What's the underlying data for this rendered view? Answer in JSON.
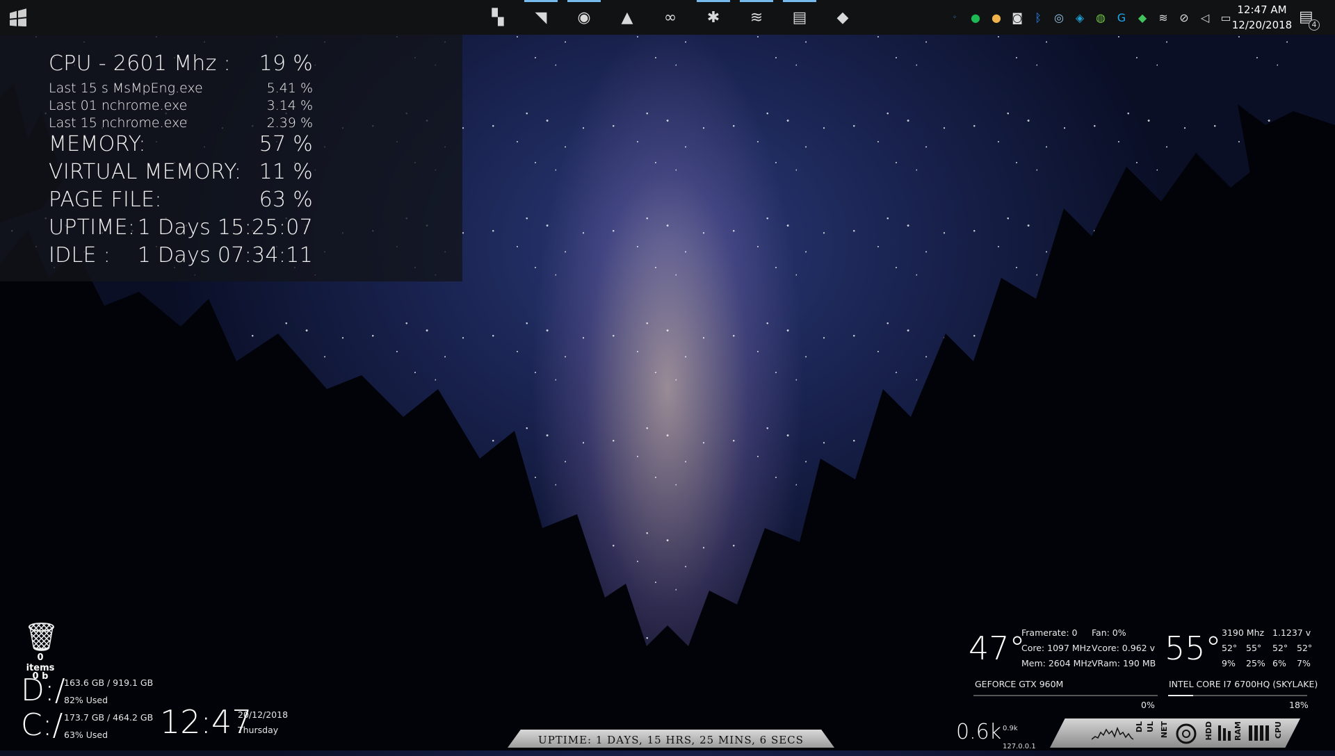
{
  "taskbar": {
    "apps": [
      {
        "name": "bookmark-app-icon",
        "glyph": "▚",
        "active": false
      },
      {
        "name": "rss-app-icon",
        "glyph": "◥",
        "active": true
      },
      {
        "name": "chrome-app-icon",
        "glyph": "◉",
        "active": true
      },
      {
        "name": "ink-app-icon",
        "glyph": "▲",
        "active": false
      },
      {
        "name": "link-app-icon",
        "glyph": "∞",
        "active": false
      },
      {
        "name": "settings-app-icon",
        "glyph": "✱",
        "active": true
      },
      {
        "name": "spotify-app-icon",
        "glyph": "≋",
        "active": true
      },
      {
        "name": "folder-app-icon",
        "glyph": "▤",
        "active": true
      },
      {
        "name": "green-app-icon",
        "glyph": "◆",
        "active": false
      }
    ],
    "clock": {
      "time": "12:47 AM",
      "date": "12/20/2018"
    },
    "notification_count": "4"
  },
  "sysmon": {
    "cpu_label": "CPU - 2601 Mhz :",
    "cpu_value": "19 %",
    "proc1_label": "Last 15 s MsMpEng.exe",
    "proc1_value": "5.41 %",
    "proc2_label": "Last 01 nchrome.exe",
    "proc2_value": "3.14 %",
    "proc3_label": "Last 15 nchrome.exe",
    "proc3_value": "2.39 %",
    "memory_label": "MEMORY:",
    "memory_value": "57 %",
    "vmem_label": "VIRTUAL MEMORY:",
    "vmem_value": "11 %",
    "page_label": "PAGE FILE:",
    "page_value": "63 %",
    "uptime_label": "UPTIME:",
    "uptime_value": "1 Days 15:25:07",
    "idle_label": "IDLE :",
    "idle_value": "1 Days 07:34:11"
  },
  "recycle": {
    "items": "0 items",
    "size": "0 b"
  },
  "drives": [
    {
      "letter": "D:/",
      "usage": "163.6 GB /  919.1 GB",
      "pct": "82% Used"
    },
    {
      "letter": "C:/",
      "usage": "173.7 GB /  464.2 GB",
      "pct": "63% Used"
    }
  ],
  "bigclock": {
    "time": "12:47",
    "date": "20/12/2018",
    "day": "Thursday"
  },
  "uptime_banner": "UPTIME: 1 DAYS, 15 HRS, 25 MINS, 6 SECS",
  "gpu": {
    "temp": "47°",
    "framerate": "Framerate: 0",
    "fan": "Fan: 0%",
    "core": "Core: 1097 MHz",
    "vcore": "Vcore: 0.962 v",
    "mem": "Mem: 2604 MHz",
    "vram": "VRam: 190 MB",
    "name": "GEFORCE GTX 960M",
    "load": "0%",
    "load_fraction": 0.0
  },
  "cpu": {
    "temp": "55°",
    "clock": "3190 Mhz",
    "voltage": "1.1237 v",
    "core_temps": [
      "52°",
      "55°",
      "52°",
      "52°"
    ],
    "core_loads": [
      "9%",
      "25%",
      "6%",
      "7%"
    ],
    "name": "INTEL CORE I7 6700HQ (SKYLAKE)",
    "load": "18%",
    "load_fraction": 0.18
  },
  "net": {
    "value": "0.6k",
    "dl": "0.9k",
    "ip": "127.0.0.1"
  },
  "meters": {
    "dl": "DL",
    "ul": "UL",
    "net": "NET",
    "hdd": "HDD",
    "ram": "RAM",
    "cpu": "CPU"
  }
}
